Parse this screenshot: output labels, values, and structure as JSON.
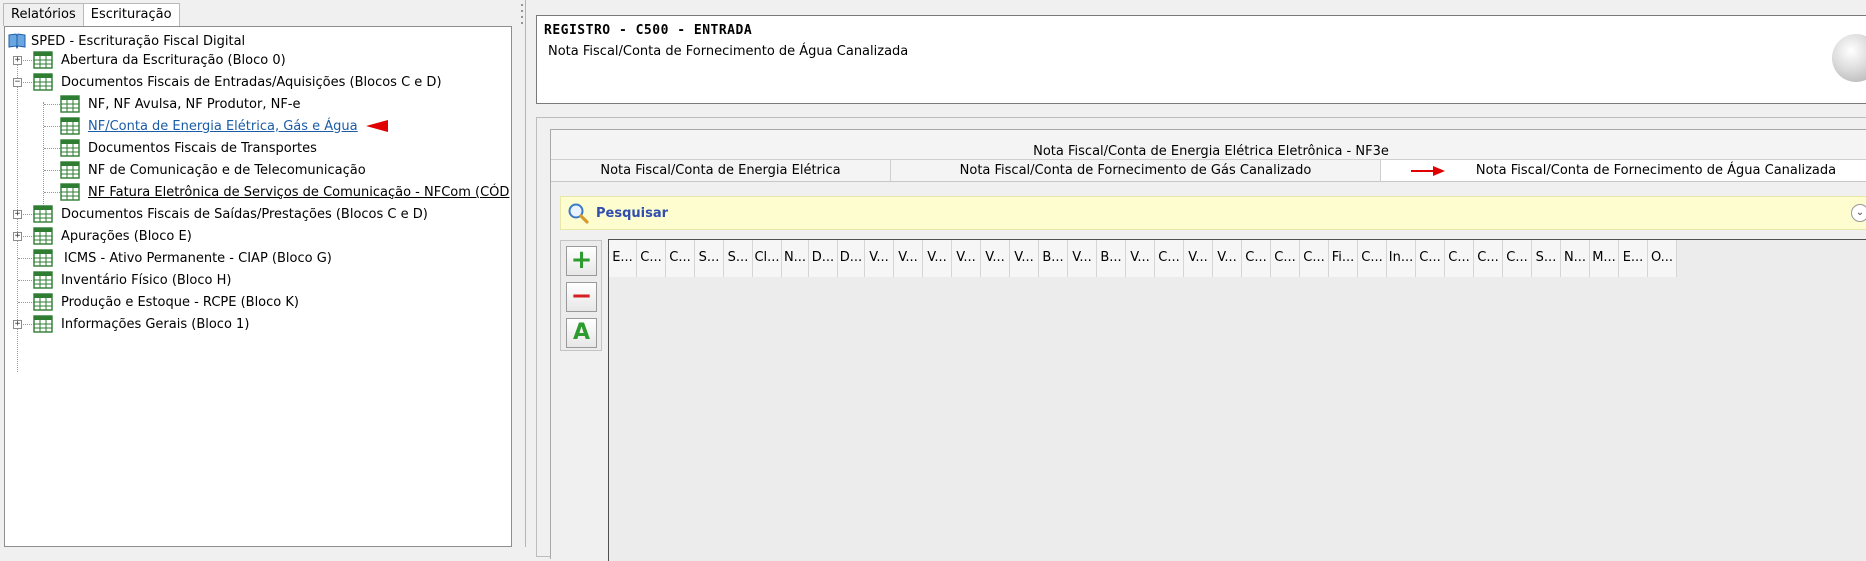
{
  "left_tabs": [
    "Relatórios",
    "Escrituração"
  ],
  "tree": {
    "root": "SPED - Escrituração Fiscal Digital",
    "items": [
      {
        "label": "Abertura da Escrituração (Bloco 0)"
      },
      {
        "label": "Documentos Fiscais de Entradas/Aquisições (Blocos C e D)"
      },
      {
        "label": "NF, NF Avulsa, NF Produtor, NF-e"
      },
      {
        "label": "NF/Conta de Energia Elétrica, Gás e Água"
      },
      {
        "label": "Documentos Fiscais de Transportes"
      },
      {
        "label": "NF de Comunicação e de Telecomunicação"
      },
      {
        "label": "NF Fatura Eletrônica de Serviços de Comunicação - NFCom (CÓD"
      },
      {
        "label": "Documentos Fiscais de Saídas/Prestações (Blocos C e D)"
      },
      {
        "label": "Apurações (Bloco E)"
      },
      {
        "label": "ICMS - Ativo Permanente - CIAP (Bloco G)"
      },
      {
        "label": "Inventário Físico (Bloco H)"
      },
      {
        "label": "Produção e Estoque - RCPE (Bloco K)"
      },
      {
        "label": "Informações Gerais (Bloco 1)"
      }
    ]
  },
  "register": {
    "title": "REGISTRO - C500 - ENTRADA",
    "subtitle": "Nota Fiscal/Conta de Fornecimento de Água Canalizada"
  },
  "content_tabs": {
    "top": "Nota Fiscal/Conta de Energia Elétrica Eletrônica - NF3e",
    "row": [
      "Nota Fiscal/Conta de Energia Elétrica",
      "Nota Fiscal/Conta de Fornecimento de Gás Canalizado",
      "Nota Fiscal/Conta de Fornecimento de Água Canalizada"
    ]
  },
  "search": {
    "label": "Pesquisar"
  },
  "buttons": {
    "add": "+",
    "remove": "−",
    "edit": "A"
  },
  "grid_columns": [
    "E...",
    "C...",
    "C...",
    "S...",
    "S...",
    "Cl...",
    "N...",
    "D...",
    "D...",
    "V...",
    "V...",
    "V...",
    "V...",
    "V...",
    "V...",
    "B...",
    "V...",
    "B...",
    "V...",
    "C...",
    "V...",
    "V...",
    "C...",
    "C...",
    "C...",
    "Fi...",
    "C...",
    "In...",
    "C...",
    "C...",
    "C...",
    "C...",
    "S...",
    "N...",
    "M...",
    "E...",
    "O..."
  ],
  "colors": {
    "tree_icon": "#2e7d32",
    "search_bg": "#fdfdcf",
    "search_text": "#2f4eb0",
    "annot_arrow": "#e00000",
    "link": "#1b5ca8"
  }
}
